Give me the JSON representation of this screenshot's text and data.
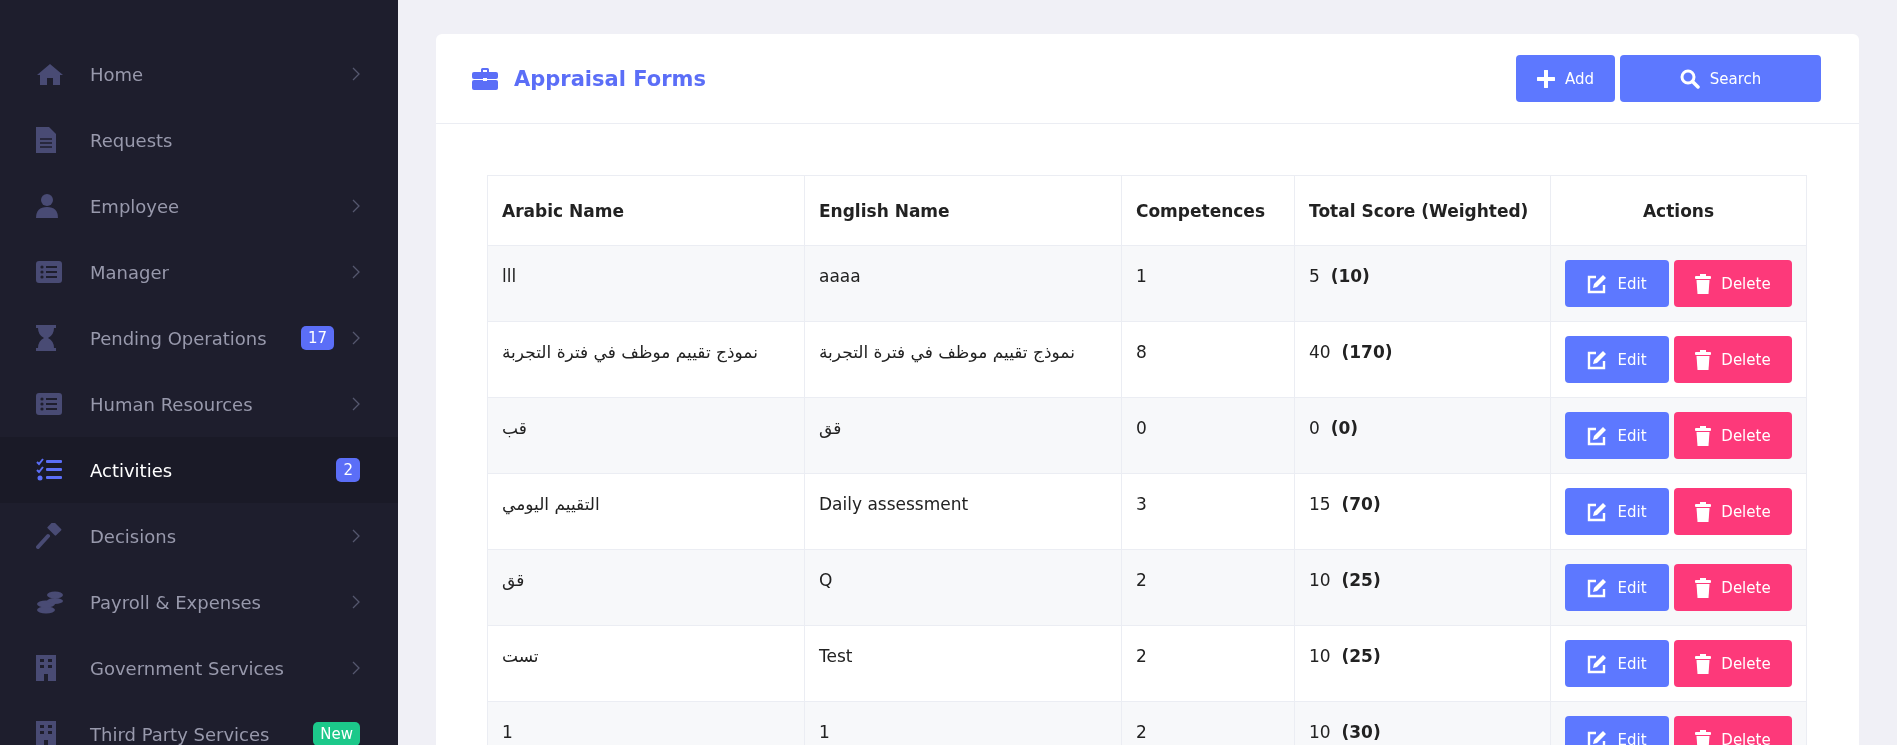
{
  "sidebar": {
    "items": [
      {
        "label": "Home",
        "chevron": true,
        "selected": false
      },
      {
        "label": "Requests",
        "chevron": false,
        "selected": false
      },
      {
        "label": "Employee",
        "chevron": true,
        "selected": false
      },
      {
        "label": "Manager",
        "chevron": true,
        "selected": false
      },
      {
        "label": "Pending Operations",
        "chevron": true,
        "selected": false,
        "badge": {
          "text": "17",
          "color": "#5b6ef7"
        }
      },
      {
        "label": "Human Resources",
        "chevron": true,
        "selected": false
      },
      {
        "label": "Activities",
        "chevron": false,
        "selected": true,
        "badge": {
          "text": "2",
          "color": "#5b6ef7"
        }
      },
      {
        "label": "Decisions",
        "chevron": true,
        "selected": false
      },
      {
        "label": "Payroll & Expenses",
        "chevron": true,
        "selected": false
      },
      {
        "label": "Government Services",
        "chevron": true,
        "selected": false
      },
      {
        "label": "Third Party Services",
        "chevron": false,
        "selected": false,
        "badge": {
          "text": "New",
          "color": "#1cc88a"
        }
      }
    ]
  },
  "page": {
    "title": "Appraisal Forms",
    "buttons": [
      {
        "label": "Add"
      },
      {
        "label": "Search"
      }
    ]
  },
  "table": {
    "columns": [
      "Arabic Name",
      "English Name",
      "Competences",
      "Total Score  (Weighted)",
      "Actions"
    ],
    "rows": [
      {
        "arabic_name": "lll",
        "english_name": "aaaa",
        "competences": "1",
        "total_score": "5  **(10)**",
        "actions": [
          "Edit",
          "Delete"
        ]
      },
      {
        "arabic_name": "نموذج تقييم موظف في فترة التجربة",
        "english_name": "نموذج تقييم موظف في فترة التجربة",
        "competences": "8",
        "total_score": "40  **(170)**",
        "actions": [
          "Edit",
          "Delete"
        ]
      },
      {
        "arabic_name": "قب",
        "english_name": "قق",
        "competences": "0",
        "total_score": "0  **(0)**",
        "actions": [
          "Edit",
          "Delete"
        ]
      },
      {
        "arabic_name": "التقييم اليومي",
        "english_name": "Daily assessment",
        "competences": "3",
        "total_score": "15  **(70)**",
        "actions": [
          "Edit",
          "Delete"
        ]
      },
      {
        "arabic_name": "قق",
        "english_name": "Q",
        "competences": "2",
        "total_score": "10  **(25)**",
        "actions": [
          "Edit",
          "Delete"
        ]
      },
      {
        "arabic_name": "تست",
        "english_name": "Test",
        "competences": "2",
        "total_score": "10  **(25)**",
        "actions": [
          "Edit",
          "Delete"
        ]
      },
      {
        "arabic_name": "1",
        "english_name": "1",
        "competences": "2",
        "total_score": "10  **(30)**",
        "actions": [
          "Edit",
          "Delete"
        ]
      }
    ]
  }
}
